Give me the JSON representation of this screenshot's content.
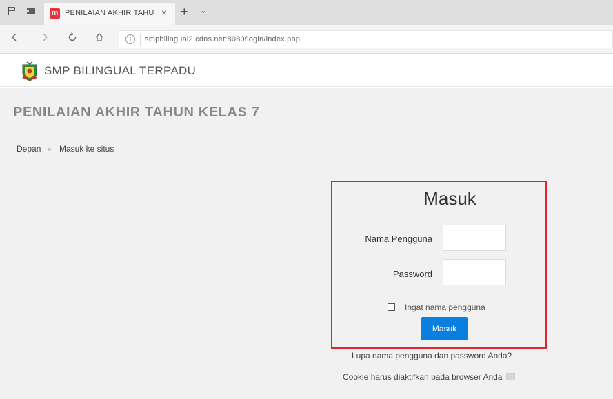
{
  "browser": {
    "tab_title": "PENILAIAN AKHIR TAHU",
    "tab_favicon_letter": "m",
    "close_tab_glyph": "×",
    "new_tab_glyph": "+",
    "tab_list_glyph": "⌄",
    "url": "smpbilingual2.cdns.net:8080/login/index.php",
    "icons": [
      "set-tabs-aside-icon",
      "tab-list-icon",
      "back-icon",
      "forward-icon",
      "refresh-icon",
      "home-icon",
      "info-icon"
    ]
  },
  "site": {
    "name": "SMP BILINGUAL TERPADU"
  },
  "page": {
    "heading": "PENILAIAN AKHIR TAHUN KELAS 7",
    "breadcrumb": [
      "Depan",
      "Masuk ke situs"
    ],
    "breadcrumb_separator": "►"
  },
  "login": {
    "title": "Masuk",
    "username_label": "Nama Pengguna",
    "username_value": "",
    "password_label": "Password",
    "password_value": "",
    "remember_label": "Ingat nama pengguna",
    "remember_checked": false,
    "button_label": "Masuk",
    "forgot_link": "Lupa nama pengguna dan password Anda?",
    "cookie_note": "Cookie harus diaktifkan pada browser Anda"
  },
  "colors": {
    "highlight_border": "#e2232a",
    "button": "#0a7fe0",
    "page_background": "#f1f1f1",
    "favicon": "#e8333d"
  }
}
